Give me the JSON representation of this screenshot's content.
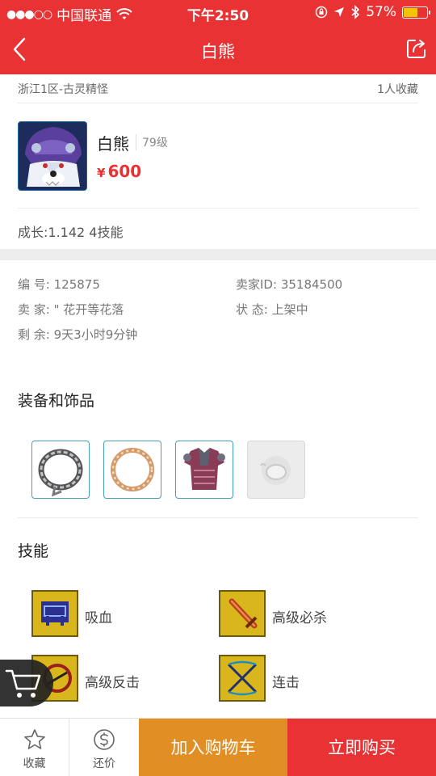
{
  "status_bar": {
    "signal": "●●●○○",
    "carrier": "中国联通",
    "time": "下午2:50",
    "battery_percent": "57%",
    "battery_level": 0.57
  },
  "nav": {
    "title": "白熊",
    "back_icon": "chevron-left-icon",
    "share_icon": "share-icon"
  },
  "server": {
    "name": "浙江1区-古灵精怪",
    "favorites": "1人收藏"
  },
  "pet": {
    "name": "白熊",
    "level": "79级",
    "currency": "¥",
    "price": "600",
    "growth": "成长:1.142 4技能"
  },
  "details": {
    "id_label": "编  号:",
    "id_value": "125875",
    "seller_id_label": "卖家ID:",
    "seller_id_value": "35184500",
    "seller_label": "卖  家:",
    "seller_value": "\" 花开等花落",
    "status_label": "状  态:",
    "status_value": "上架中",
    "remaining_label": "剩  余:",
    "remaining_value": "9天3小时9分钟"
  },
  "equipment": {
    "title": "装备和饰品",
    "items": [
      {
        "icon": "chain-ring-icon"
      },
      {
        "icon": "bead-ring-icon"
      },
      {
        "icon": "armor-icon"
      },
      {
        "icon": "empty-slot-icon"
      }
    ]
  },
  "skills": {
    "title": "技能",
    "items": [
      {
        "name": "吸血",
        "icon": "vampire-skill-icon"
      },
      {
        "name": "高级必杀",
        "icon": "sword-skill-icon"
      },
      {
        "name": "高级反击",
        "icon": "counter-skill-icon"
      },
      {
        "name": "连击",
        "icon": "combo-skill-icon"
      }
    ]
  },
  "bottom_bar": {
    "favorite_label": "收藏",
    "bargain_label": "还价",
    "add_to_cart_label": "加入购物车",
    "buy_now_label": "立即购买"
  },
  "colors": {
    "brand_red": "#e83233",
    "cart_orange": "#e18e24",
    "skill_gold": "#d7b41a"
  }
}
